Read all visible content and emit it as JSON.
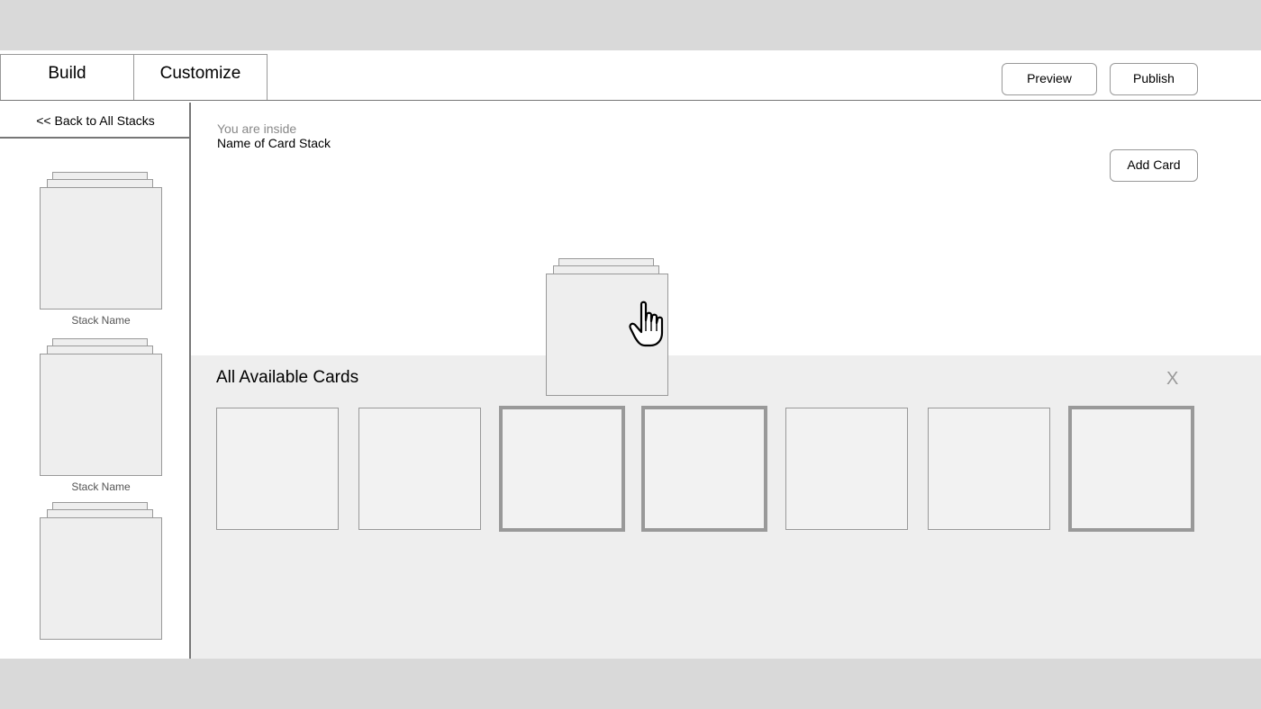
{
  "tabs": [
    {
      "label": "Build"
    },
    {
      "label": "Customize"
    }
  ],
  "actions": {
    "preview_label": "Preview",
    "publish_label": "Publish",
    "add_card_label": "Add Card"
  },
  "sidebar": {
    "back_label": "<< Back to All Stacks",
    "stacks": [
      {
        "name": "Stack Name"
      },
      {
        "name": "Stack Name"
      },
      {
        "name": ""
      }
    ]
  },
  "main": {
    "context_label": "You are inside",
    "stack_name": "Name of Card Stack"
  },
  "drawer": {
    "title": "All Available Cards",
    "close_label": "X",
    "cards": [
      {
        "selected": false
      },
      {
        "selected": false
      },
      {
        "selected": true
      },
      {
        "selected": true
      },
      {
        "selected": false
      },
      {
        "selected": false
      },
      {
        "selected": true
      }
    ]
  },
  "cursor": {
    "icon": "hand-pointer-icon"
  },
  "colors": {
    "page_bg": "#d9d9d9",
    "panel_bg": "#eeeeee",
    "border": "#999999"
  }
}
